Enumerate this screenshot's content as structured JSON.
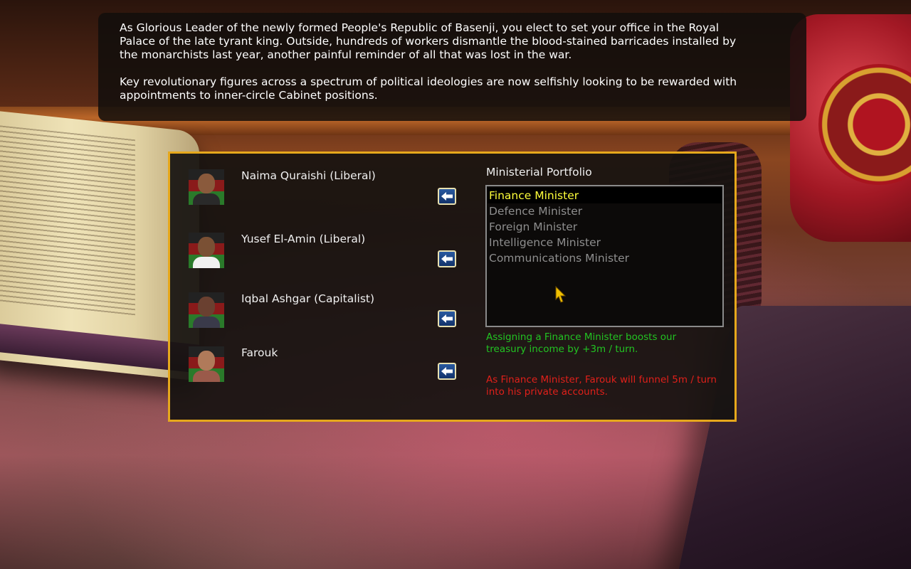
{
  "intro": {
    "paragraph1": "As Glorious Leader of the newly formed People's Republic of Basenji, you elect to set your office in the Royal\nPalace of the late tyrant king.  Outside, hundreds of workers dismantle the blood-stained barricades installed by\nthe monarchists last year, another painful reminder of all that was lost in the war.",
    "paragraph2": "Key revolutionary figures across a spectrum of political ideologies are now selfishly looking to be rewarded with\nappointments to inner-circle Cabinet positions."
  },
  "candidates": [
    {
      "name": "Naima Quraishi  (Liberal)",
      "skin": "#8a5a3c",
      "clothes": "#2a2a2a"
    },
    {
      "name": "Yusef El-Amin  (Liberal)",
      "skin": "#7a5034",
      "clothes": "#f0f0f0"
    },
    {
      "name": "Iqbal Ashgar  (Capitalist)",
      "skin": "#6a4030",
      "clothes": "#3a3a4a"
    },
    {
      "name": "Farouk",
      "skin": "#b07a5a",
      "clothes": "#9a5a4a"
    }
  ],
  "portfolio": {
    "title": "Ministerial Portfolio",
    "items": [
      "Finance Minister",
      "Defence Minister",
      "Foreign Minister",
      "Intelligence Minister",
      "Communications Minister"
    ],
    "selected_index": 0
  },
  "notes": {
    "benefit": "Assigning a Finance Minister boosts our treasury income by +3m / turn.",
    "corruption": "As Finance Minister, Farouk will funnel 5m / turn into his private accounts."
  },
  "colors": {
    "frame": "#e6a81c",
    "selected_text": "#ffff3a",
    "benefit_text": "#22c322",
    "corruption_text": "#e0201a"
  },
  "icons": {
    "assign_button": "arrow-left-icon",
    "pointer": "mouse-cursor-icon"
  }
}
